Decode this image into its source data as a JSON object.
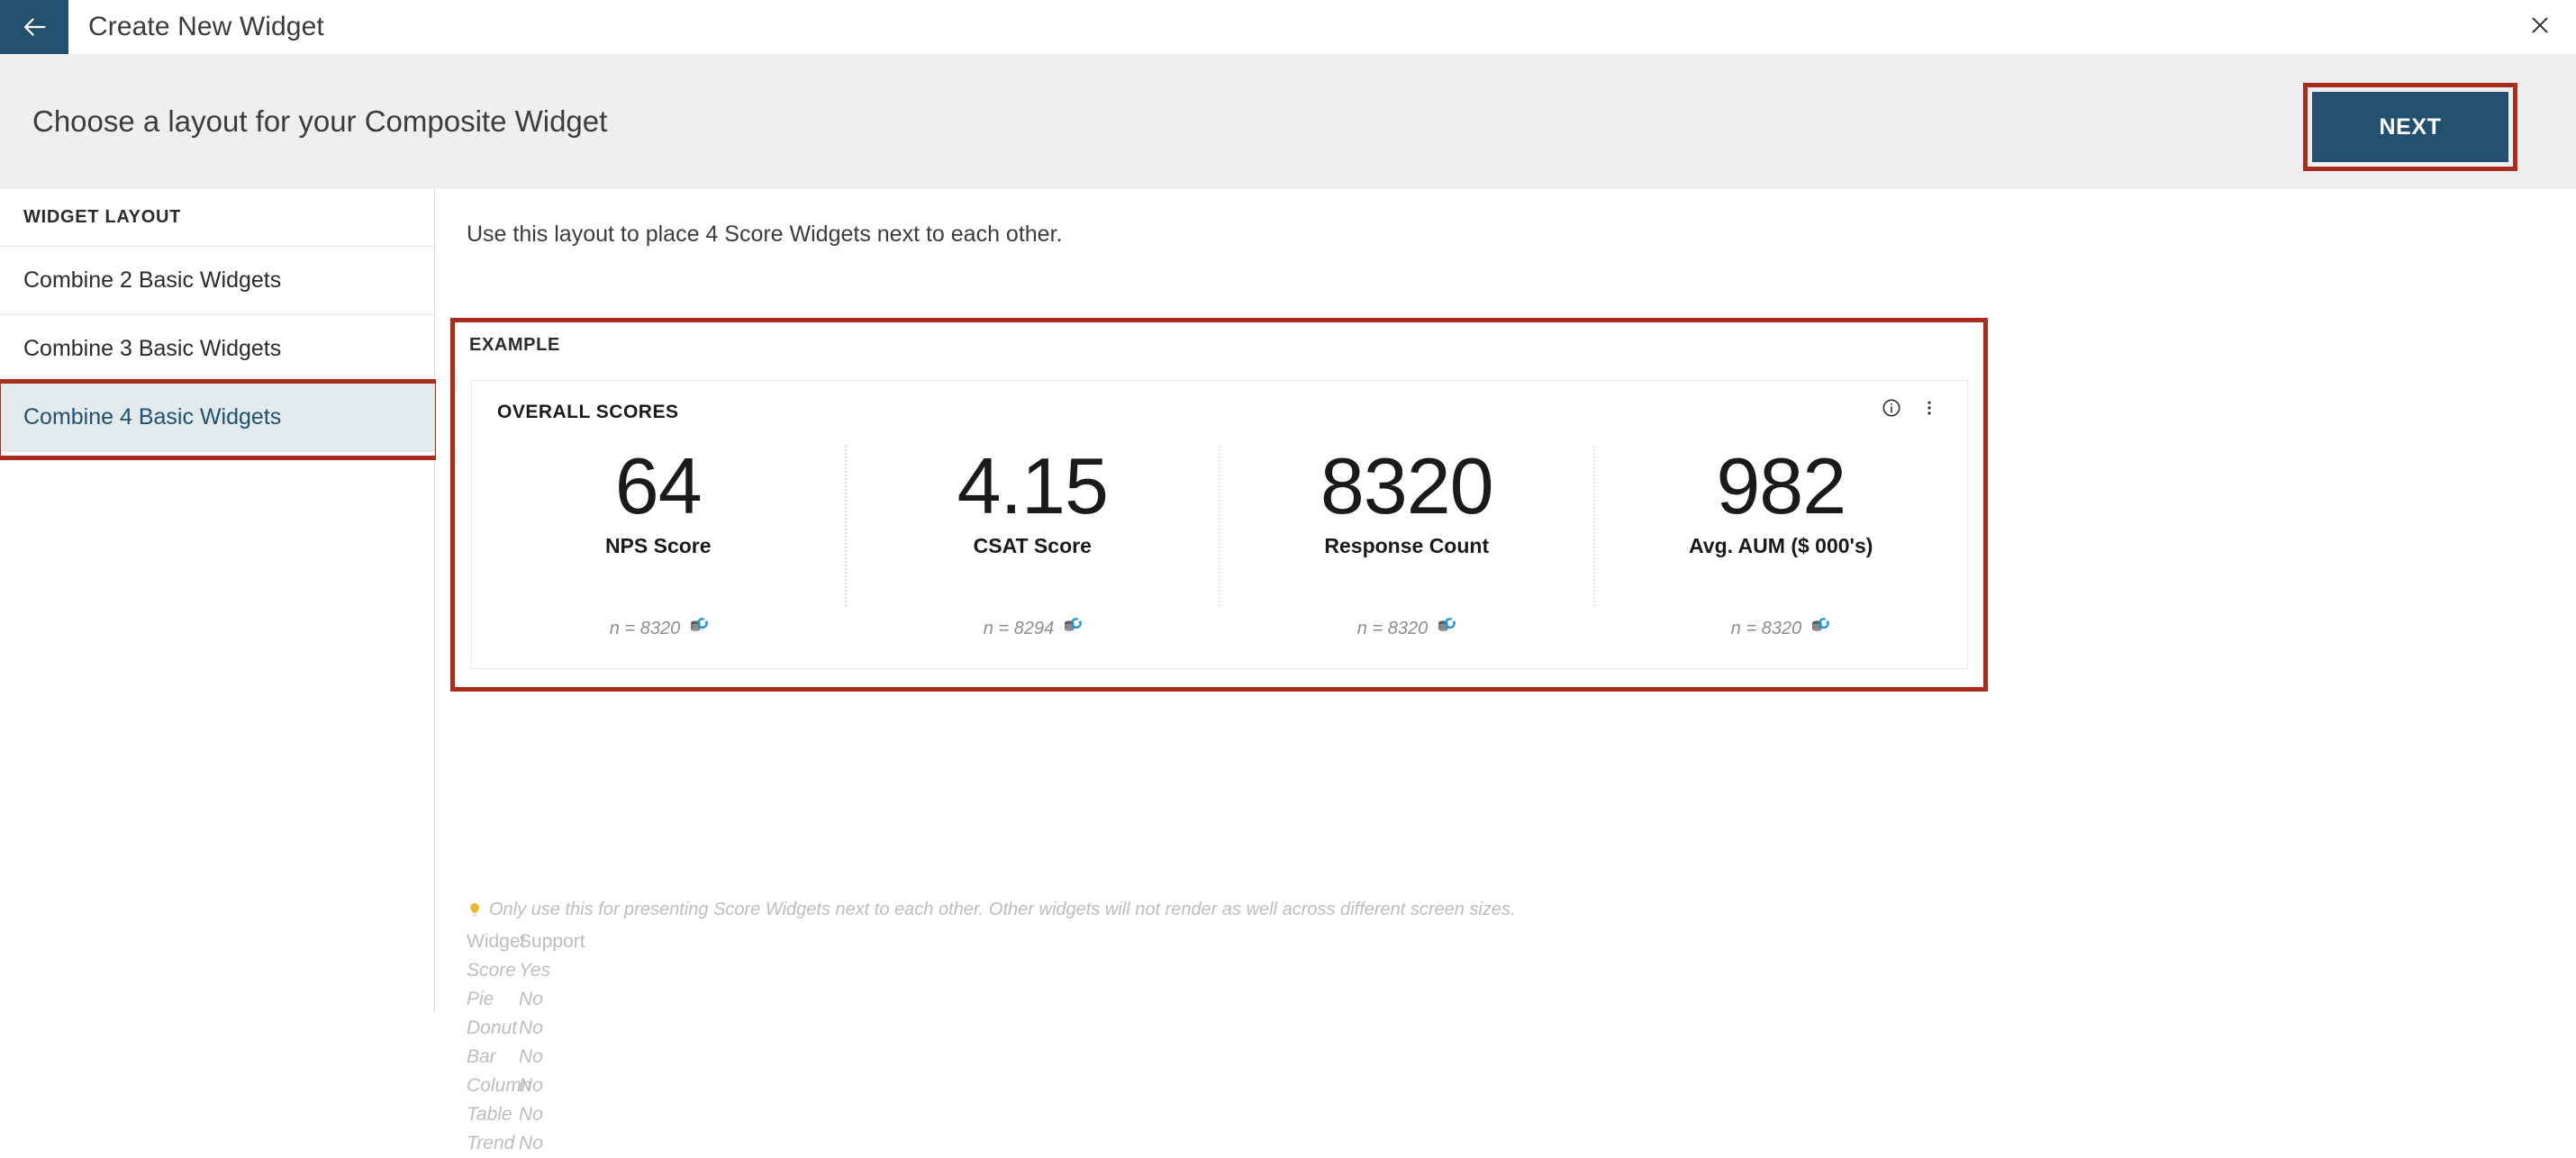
{
  "topbar": {
    "back_icon": "arrow-left-icon",
    "title": "Create New Widget",
    "close_icon": "close-icon"
  },
  "subheader": {
    "title": "Choose a layout for your Composite Widget",
    "next_label": "NEXT"
  },
  "sidebar": {
    "header": "WIDGET LAYOUT",
    "items": [
      {
        "label": "Combine 2 Basic Widgets",
        "selected": false
      },
      {
        "label": "Combine 3 Basic Widgets",
        "selected": false
      },
      {
        "label": "Combine 4 Basic Widgets",
        "selected": true
      }
    ]
  },
  "main": {
    "intro": "Use this layout to place 4 Score Widgets next to each other.",
    "example_label": "EXAMPLE",
    "widget": {
      "title": "OVERALL SCORES",
      "info_icon": "info-circle-icon",
      "menu_icon": "more-vertical-icon",
      "scores": [
        {
          "value": "64",
          "label": "NPS Score",
          "n": "n = 8320",
          "source_icon": "database-refresh-icon"
        },
        {
          "value": "4.15",
          "label": "CSAT Score",
          "n": "n = 8294",
          "source_icon": "database-refresh-icon"
        },
        {
          "value": "8320",
          "label": "Response Count",
          "n": "n = 8320",
          "source_icon": "database-refresh-icon"
        },
        {
          "value": "982",
          "label": "Avg. AUM ($ 000's)",
          "n": "n = 8320",
          "source_icon": "database-refresh-icon"
        }
      ]
    },
    "note": {
      "icon": "lightbulb-icon",
      "text": "Only use this for presenting Score Widgets next to each other. Other widgets will not render as well across different screen sizes."
    },
    "support": {
      "col1": "Widget",
      "col2": "Support",
      "rows": [
        {
          "widget": "Score",
          "support": "Yes"
        },
        {
          "widget": "Pie",
          "support": "No"
        },
        {
          "widget": "Donut",
          "support": "No"
        },
        {
          "widget": "Bar",
          "support": "No"
        },
        {
          "widget": "Column",
          "support": "No"
        },
        {
          "widget": "Table",
          "support": "No"
        },
        {
          "widget": "Trend",
          "support": "No"
        }
      ]
    }
  },
  "colors": {
    "brand_blue": "#22506e",
    "highlight_red": "#a92d1c",
    "subheader_bg": "#efefef",
    "selected_item_bg": "#e2eaee"
  }
}
